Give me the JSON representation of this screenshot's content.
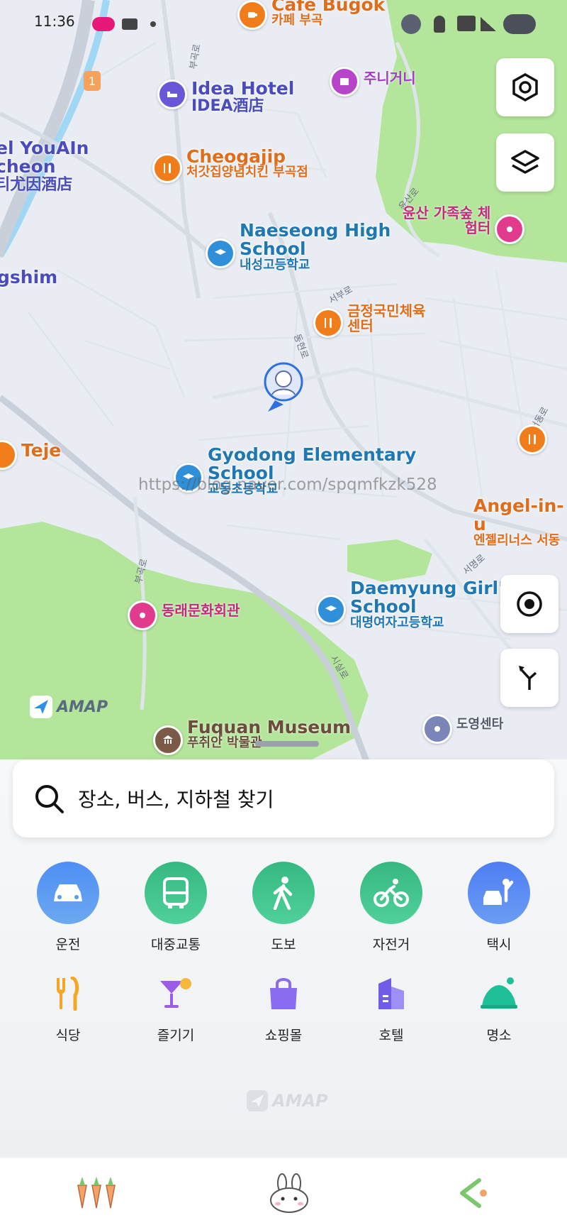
{
  "status_bar": {
    "time": "11:36"
  },
  "map": {
    "pois": [
      {
        "id": "cafe-bugok",
        "en": "Cafe Bugok",
        "ko": "카페 부곡"
      },
      {
        "id": "hotel",
        "en": "Idea Hotel",
        "ko": "IDEA酒店"
      },
      {
        "id": "jyunigeoni",
        "ko": "주니거니"
      },
      {
        "id": "hotel-youain",
        "en": "el YouAIn",
        "en2": "cheon",
        "ko": "티尤因酒店"
      },
      {
        "id": "cheogajip",
        "en": "Cheogajip",
        "ko": "처갓집양념치킨 부곡점"
      },
      {
        "id": "naeseong",
        "en": "Naeseong High",
        "en2": "School",
        "ko": "내성고등학교"
      },
      {
        "id": "yunsan",
        "ko": "윤산 가족숲 체",
        "ko2": "험터"
      },
      {
        "id": "gymnasium",
        "ko": "금정국민체육",
        "ko2": "센터"
      },
      {
        "id": "gshim",
        "en": "gshim"
      },
      {
        "id": "teje",
        "en": "Teje"
      },
      {
        "id": "gyodong",
        "en": "Gyodong Elementary",
        "en2": "School",
        "ko": "교동초등학교"
      },
      {
        "id": "angel",
        "en": "Angel-in-u",
        "ko": "엔젤리너스 서동"
      },
      {
        "id": "daemyung",
        "en": "Daemyung Girl's",
        "en2": "School",
        "ko": "대명여자고등학교"
      },
      {
        "id": "dongnae-culture",
        "ko": "동래문화회관"
      },
      {
        "id": "fuquan",
        "en": "Fuquan Museum",
        "ko": "푸취안 박물관"
      },
      {
        "id": "doyoung",
        "ko": "도영센타"
      }
    ],
    "roads": {
      "r1": "부곡로",
      "r2": "윤산로",
      "r3": "서부로",
      "r4": "동현로",
      "r5": "서동로",
      "r6": "서명로",
      "r7": "시실로",
      "r8": "부곡로"
    },
    "watermark": "https://blog.naver.com/spqmfkzk528",
    "logo": "AMAP",
    "route_badge": "1"
  },
  "search": {
    "placeholder": "장소, 버스, 지하철 찾기"
  },
  "transport": [
    {
      "label": "운전",
      "icon": "car-icon",
      "color": "#5b9cf2"
    },
    {
      "label": "대중교통",
      "icon": "bus-icon",
      "color": "#3cc28e"
    },
    {
      "label": "도보",
      "icon": "walk-icon",
      "color": "#3cc28e"
    },
    {
      "label": "자전거",
      "icon": "bicycle-icon",
      "color": "#3cc28e"
    },
    {
      "label": "택시",
      "icon": "taxi-icon",
      "color": "#5b8ff2"
    }
  ],
  "categories": [
    {
      "label": "식당",
      "icon": "restaurant-icon",
      "color": "#f5a623"
    },
    {
      "label": "즐기기",
      "icon": "cocktail-icon",
      "color": "#9b5de5"
    },
    {
      "label": "쇼핑몰",
      "icon": "shopping-bag-icon",
      "color": "#8a6cf0"
    },
    {
      "label": "호텔",
      "icon": "hotel-icon",
      "color": "#7b6cf0"
    },
    {
      "label": "명소",
      "icon": "landmark-icon",
      "color": "#1fbf9a"
    }
  ],
  "footer_logo": "AMAP"
}
